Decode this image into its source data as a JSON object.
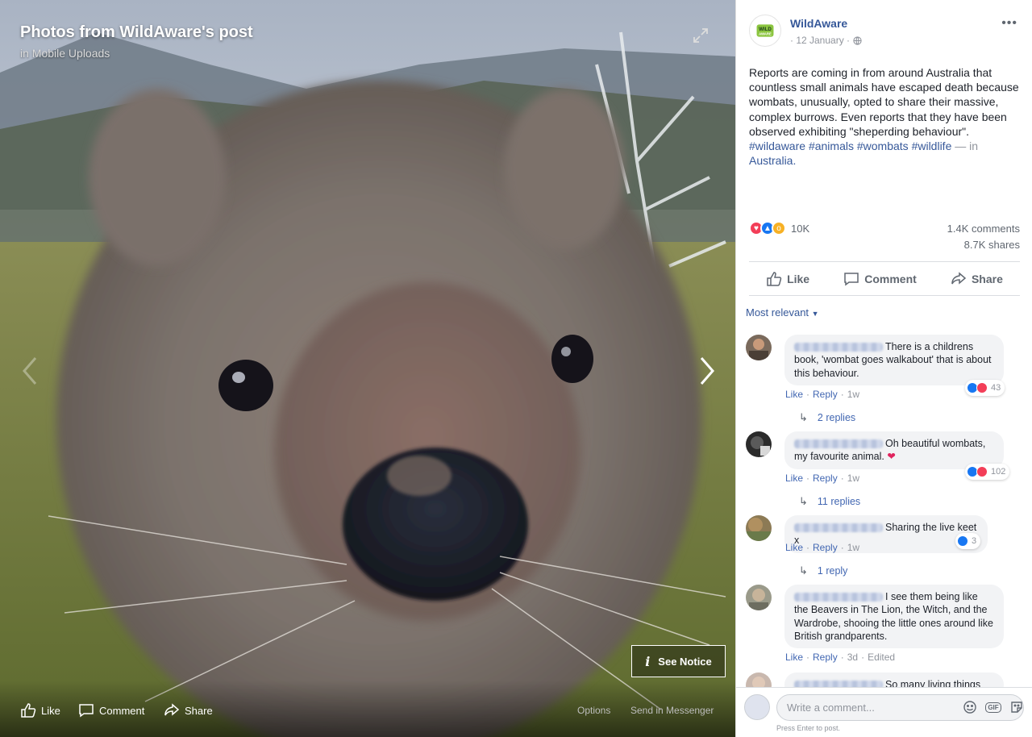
{
  "stage": {
    "title": "Photos from WildAware's post",
    "subtitle": "in Mobile Uploads",
    "see_notice": "See Notice",
    "bottom_actions": {
      "like": "Like",
      "comment": "Comment",
      "share": "Share"
    },
    "links": {
      "options": "Options",
      "send": "Send in Messenger"
    }
  },
  "post": {
    "page_name": "WildAware",
    "logo_text_1": "WILD",
    "logo_text_2": "AWARE",
    "date": "· 12 January ·",
    "body": "Reports are coming in from around Australia that countless small animals have escaped death because wombats, unusually, opted to share their massive, complex burrows. Even reports that they have been observed exhibiting \"sheperding behaviour\".",
    "hashtags": [
      "#wildaware",
      "#animals",
      "#wombats",
      "#wildlife"
    ],
    "location_prefix": "— in",
    "location": "Australia.",
    "reactions_count": "10K",
    "comments_count": "1.4K comments",
    "shares_count": "8.7K shares",
    "actions": {
      "like": "Like",
      "comment": "Comment",
      "share": "Share"
    },
    "sort_label": "Most relevant"
  },
  "comments": [
    {
      "text": "There is a childrens book, 'wombat goes walkabout' that is about this behaviour.",
      "reactions": "43",
      "like": "Like",
      "reply": "Reply",
      "time": "1w",
      "edited": "",
      "replies": "2 replies"
    },
    {
      "text": "Oh beautiful wombats, my favourite animal.",
      "reactions": "102",
      "like": "Like",
      "reply": "Reply",
      "time": "1w",
      "edited": "",
      "replies": "11 replies"
    },
    {
      "text": "Sharing the live keet x",
      "reactions": "3",
      "like": "Like",
      "reply": "Reply",
      "time": "1w",
      "edited": "",
      "replies": "1 reply"
    },
    {
      "text": "I see them being like the Beavers in The Lion, the Witch, and the Wardrobe, shooing the little ones around like British grandparents.",
      "reactions": "",
      "like": "Like",
      "reply": "Reply",
      "time": "3d",
      "edited": "Edited",
      "replies": ""
    },
    {
      "text": "So many living things",
      "reactions": "",
      "like": "",
      "reply": "",
      "time": "",
      "edited": "",
      "replies": ""
    }
  ],
  "composer": {
    "placeholder": "Write a comment...",
    "hint": "Press Enter to post.",
    "gif_label": "GIF"
  },
  "colors": {
    "link": "#365899",
    "panel_bg": "#ffffff",
    "bubble": "#f2f3f5"
  }
}
